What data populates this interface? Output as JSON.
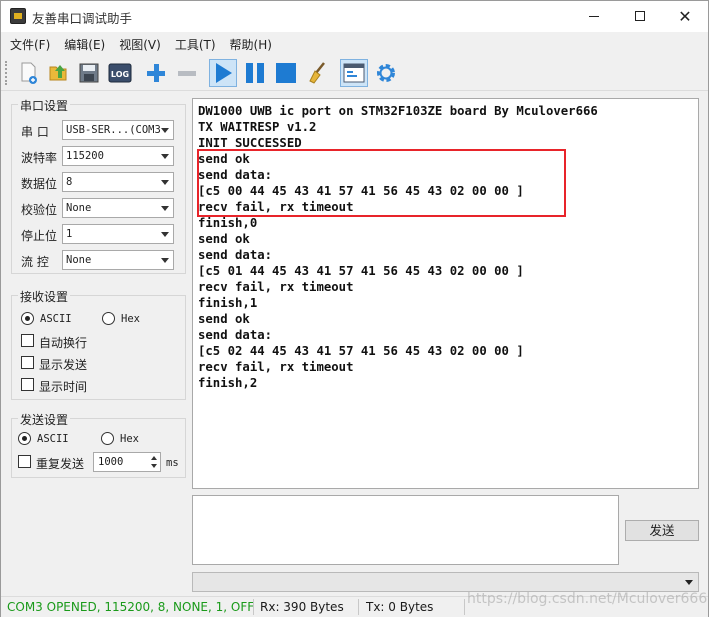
{
  "window": {
    "title": "友善串口调试助手",
    "controls": {
      "minimize": "—",
      "maximize": "☐",
      "close": "✕"
    }
  },
  "menu": [
    "文件(F)",
    "编辑(E)",
    "视图(V)",
    "工具(T)",
    "帮助(H)"
  ],
  "toolbar": {
    "icons": [
      "new-file-icon",
      "open-folder-icon",
      "save-icon",
      "log-icon",
      "add-icon",
      "remove-icon",
      "start-icon",
      "pause-icon",
      "stop-icon",
      "clear-icon",
      "window-layout-icon",
      "settings-icon"
    ],
    "log_label": "LOG"
  },
  "serial_settings": {
    "title": "串口设置",
    "port_label": "串  口",
    "port_value": "USB-SER...(COM3",
    "baud_label": "波特率",
    "baud_value": "115200",
    "databits_label": "数据位",
    "databits_value": "8",
    "parity_label": "校验位",
    "parity_value": "None",
    "stopbits_label": "停止位",
    "stopbits_value": "1",
    "flow_label": "流  控",
    "flow_value": "None"
  },
  "recv_settings": {
    "title": "接收设置",
    "ascii_label": "ASCII",
    "hex_label": "Hex",
    "auto_wrap": "自动换行",
    "show_send": "显示发送",
    "show_time": "显示时间"
  },
  "send_settings": {
    "title": "发送设置",
    "ascii_label": "ASCII",
    "hex_label": "Hex",
    "repeat_label": "重复发送",
    "interval_value": "1000",
    "interval_unit": "ms"
  },
  "receive_lines": [
    "DW1000 UWB ic port on STM32F103ZE board By Mculover666",
    "TX WAITRESP v1.2",
    "INIT SUCCESSED",
    "send ok",
    "send data:",
    "[c5 00 44 45 43 41 57 41 56 45 43 02 00 00 ]",
    "recv fail, rx timeout",
    "finish,0",
    "send ok",
    "send data:",
    "[c5 01 44 45 43 41 57 41 56 45 43 02 00 00 ]",
    "recv fail, rx timeout",
    "finish,1",
    "send ok",
    "send data:",
    "[c5 02 44 45 43 41 57 41 56 45 43 02 00 00 ]",
    "recv fail, rx timeout",
    "finish,2"
  ],
  "send_button": "发送",
  "status": {
    "connection": "COM3 OPENED, 115200, 8, NONE, 1, OFF",
    "rx": "Rx: 390 Bytes",
    "tx": "Tx: 0 Bytes"
  },
  "watermark": "https://blog.csdn.net/Mculover666",
  "colors": {
    "status_ok": "#1a9a1a",
    "highlight_border": "#e8242a",
    "toolbar_blue": "#1e7bd2"
  }
}
